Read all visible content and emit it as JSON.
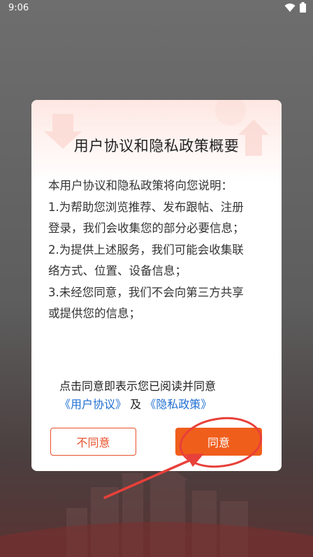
{
  "status_bar": {
    "time": "9:06"
  },
  "dialog": {
    "title": "用户协议和隐私政策概要",
    "body_lines": [
      "本用户协议和隐私政策将向您说明：",
      "1.为帮助您浏览推荐、发布跟帖、注册",
      "登录，我们会收集您的部分必要信息；",
      "2.为提供上述服务，我们可能会收集联",
      "络方式、位置、设备信息；",
      "3.未经您同意，我们不会向第三方共享",
      "或提供您的信息；"
    ],
    "consent_text": "点击同意即表示您已阅读并同意",
    "user_agreement_link": "《用户协议》",
    "and_text": " 及 ",
    "privacy_policy_link": "《隐私政策》",
    "disagree_label": "不同意",
    "agree_label": "同意"
  },
  "colors": {
    "accent": "#f05e1c",
    "link": "#1f6fd1",
    "annotation": "#e8403a"
  }
}
